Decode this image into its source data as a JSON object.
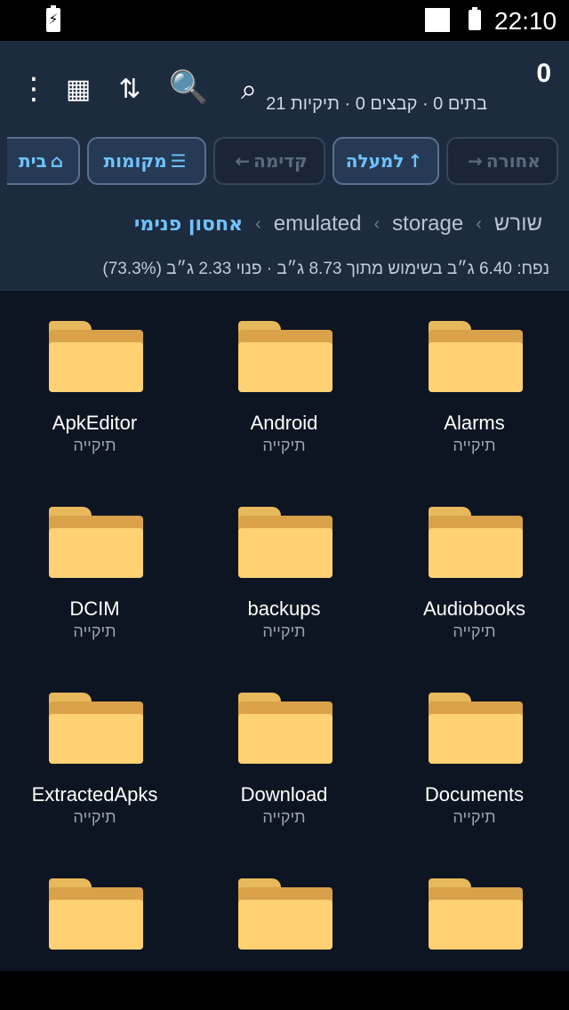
{
  "status_bar": {
    "time": "22:10",
    "charging_glyph": "⚡"
  },
  "toolbar": {
    "more_glyph": "⋮",
    "grid_glyph": "▦",
    "sort_glyph": "⇅",
    "magnify_glyph": "🔍",
    "search_glyph": "⌕",
    "count_number": "0",
    "count_summary": "בתים 0 · קבצים 0 · תיקיות 21"
  },
  "nav": {
    "back_label": "אחורה",
    "back_glyph": "→",
    "up_label": "למעלה",
    "up_glyph": "↑",
    "forward_label": "קדימה",
    "forward_glyph": "←",
    "places_label": "מקומות",
    "places_glyph": "☰",
    "home_label": "בית",
    "home_glyph": "⌂"
  },
  "breadcrumb": {
    "items": [
      "שורש",
      "storage",
      "emulated",
      "אחסון פנימי"
    ],
    "separator": "›"
  },
  "storage_info": "נפח: 6.40 ג״ב בשימוש מתוך 8.73 ג״ב  ·  פנוי 2.33 ג״ב  (73.3%)",
  "files": [
    {
      "name": "Alarms",
      "type": "תיקייה"
    },
    {
      "name": "Android",
      "type": "תיקייה"
    },
    {
      "name": "ApkEditor",
      "type": "תיקייה"
    },
    {
      "name": "Audiobooks",
      "type": "תיקייה"
    },
    {
      "name": "backups",
      "type": "תיקייה"
    },
    {
      "name": "DCIM",
      "type": "תיקייה"
    },
    {
      "name": "Documents",
      "type": "תיקייה"
    },
    {
      "name": "Download",
      "type": "תיקייה"
    },
    {
      "name": "ExtractedApks",
      "type": "תיקייה"
    },
    {
      "name": "",
      "type": ""
    },
    {
      "name": "",
      "type": ""
    },
    {
      "name": "",
      "type": ""
    }
  ],
  "colors": {
    "header_bg": "#1d2b3f",
    "accent": "#6fc3ff",
    "folder": "#ffd173",
    "list_bg": "#0e1522"
  }
}
